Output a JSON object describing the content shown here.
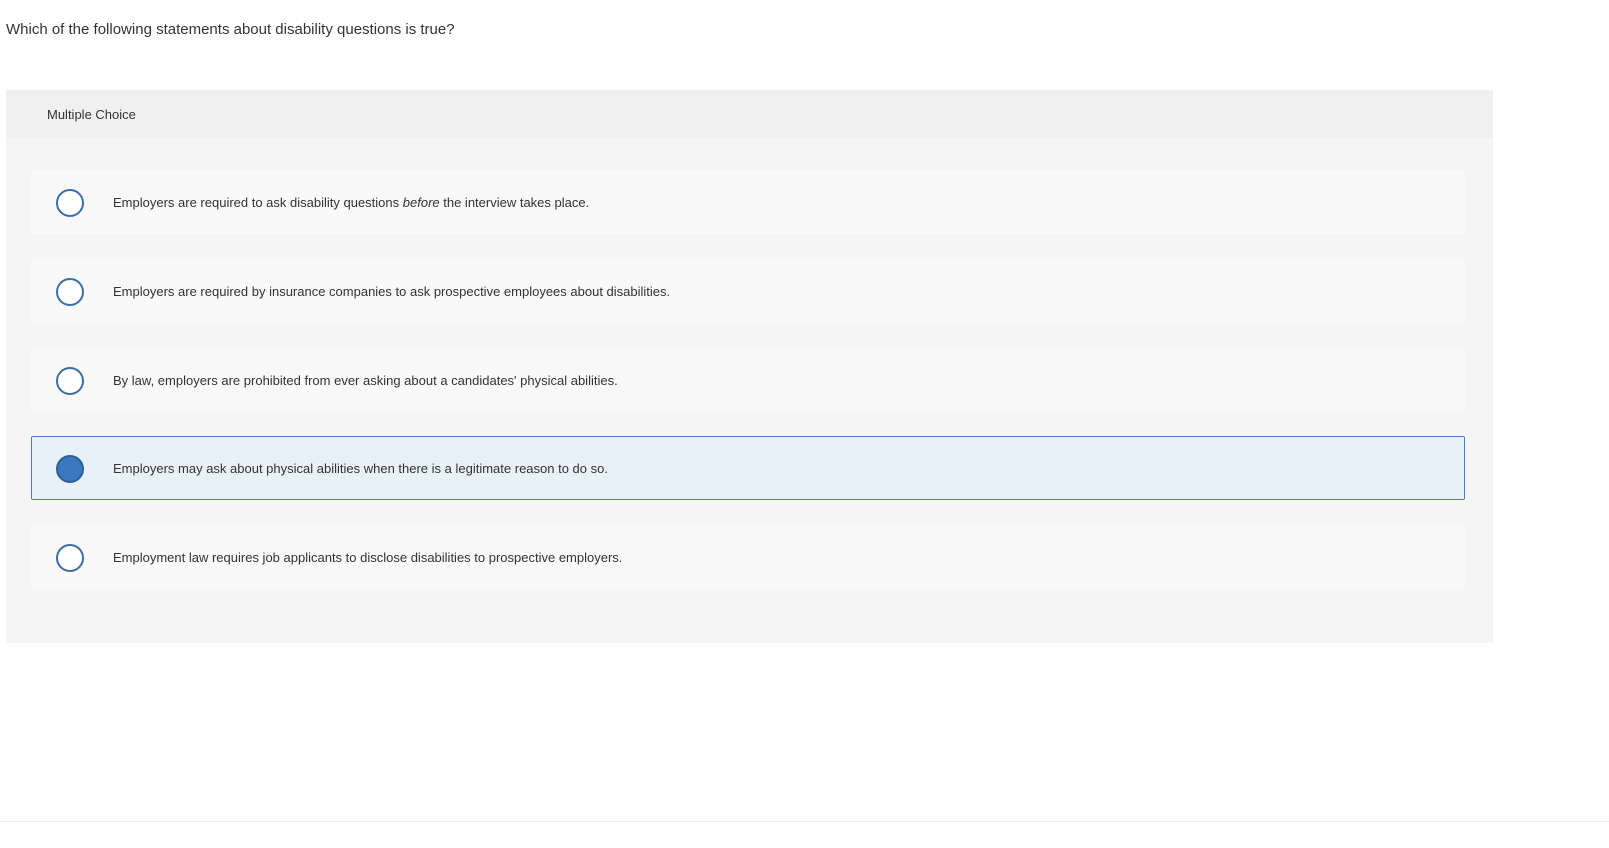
{
  "question": {
    "text": "Which of the following statements about disability questions is true?"
  },
  "panel": {
    "header_label": "Multiple Choice"
  },
  "options": [
    {
      "text_before": "Employers are required to ask disability questions ",
      "text_emphasis": "before",
      "text_after": " the interview takes place.",
      "selected": false
    },
    {
      "text": "Employers are required by insurance companies to ask prospective employees about disabilities.",
      "selected": false
    },
    {
      "text": "By law, employers are prohibited from ever asking about a candidates' physical abilities.",
      "selected": false
    },
    {
      "text": "Employers may ask about physical abilities when there is a legitimate reason to do so.",
      "selected": true
    },
    {
      "text": "Employment law requires job applicants to disclose disabilities to prospective employers.",
      "selected": false
    }
  ],
  "colors": {
    "selected_fill": "#3a78bf",
    "selected_background": "#e8f1fa",
    "radio_border": "#3a6ea5"
  }
}
